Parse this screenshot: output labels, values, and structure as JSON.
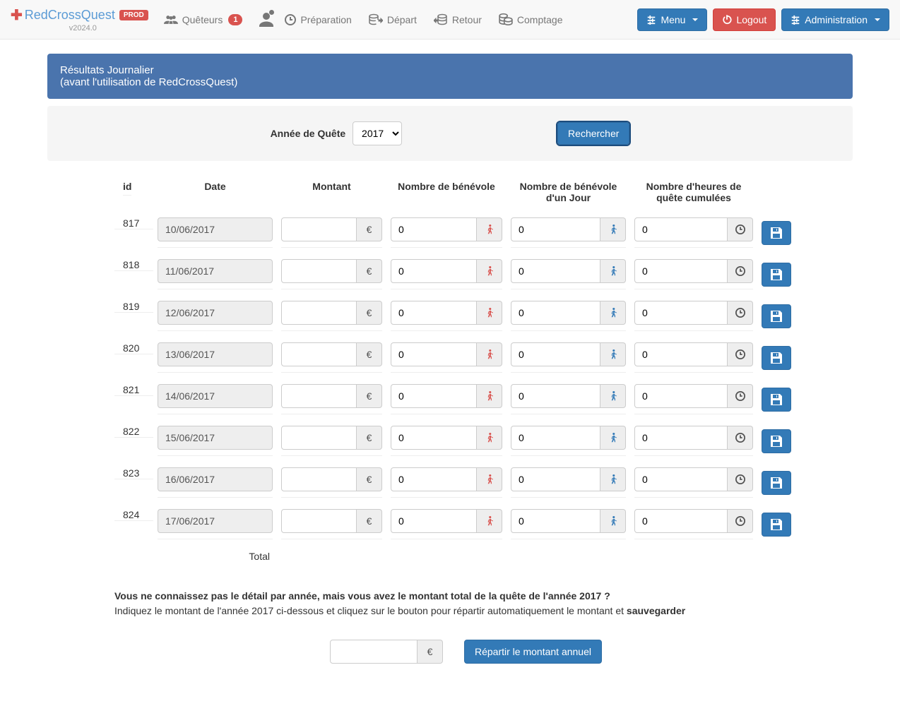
{
  "brand": {
    "name": "RedCrossQuest",
    "badge": "PROD",
    "version": "v2024.0"
  },
  "nav": {
    "queteurs": "Quêteurs",
    "queteurs_count": "1",
    "preparation": "Préparation",
    "depart": "Départ",
    "retour": "Retour",
    "comptage": "Comptage"
  },
  "buttons": {
    "menu": "Menu",
    "logout": "Logout",
    "admin": "Administration"
  },
  "panel": {
    "title": "Résultats Journalier",
    "subtitle": "(avant l'utilisation de RedCrossQuest)"
  },
  "search": {
    "label": "Année de Quête",
    "year": "2017",
    "button": "Rechercher"
  },
  "table": {
    "headers": {
      "id": "id",
      "date": "Date",
      "montant": "Montant",
      "benevole": "Nombre de bénévole",
      "benevole_jour": "Nombre de bénévole d'un Jour",
      "heures": "Nombre d'heures de quête cumulées"
    },
    "rows": [
      {
        "id": "817",
        "date": "10/06/2017",
        "montant": "",
        "benevole": "0",
        "benevole_jour": "0",
        "heures": "0"
      },
      {
        "id": "818",
        "date": "11/06/2017",
        "montant": "",
        "benevole": "0",
        "benevole_jour": "0",
        "heures": "0"
      },
      {
        "id": "819",
        "date": "12/06/2017",
        "montant": "",
        "benevole": "0",
        "benevole_jour": "0",
        "heures": "0"
      },
      {
        "id": "820",
        "date": "13/06/2017",
        "montant": "",
        "benevole": "0",
        "benevole_jour": "0",
        "heures": "0"
      },
      {
        "id": "821",
        "date": "14/06/2017",
        "montant": "",
        "benevole": "0",
        "benevole_jour": "0",
        "heures": "0"
      },
      {
        "id": "822",
        "date": "15/06/2017",
        "montant": "",
        "benevole": "0",
        "benevole_jour": "0",
        "heures": "0"
      },
      {
        "id": "823",
        "date": "16/06/2017",
        "montant": "",
        "benevole": "0",
        "benevole_jour": "0",
        "heures": "0"
      },
      {
        "id": "824",
        "date": "17/06/2017",
        "montant": "",
        "benevole": "0",
        "benevole_jour": "0",
        "heures": "0"
      }
    ],
    "total_label": "Total",
    "euro": "€"
  },
  "footer": {
    "q1a": "Vous ne connaissez pas le détail par année, mais vous avez le montant total de la quête de l'année 2017 ?",
    "q2a": "Indiquez le montant de l'année 2017 ci-dessous et cliquez sur le bouton pour répartir automatiquement le montant et ",
    "q2b": "sauvegarder",
    "repartir": "Répartir le montant annuel"
  }
}
